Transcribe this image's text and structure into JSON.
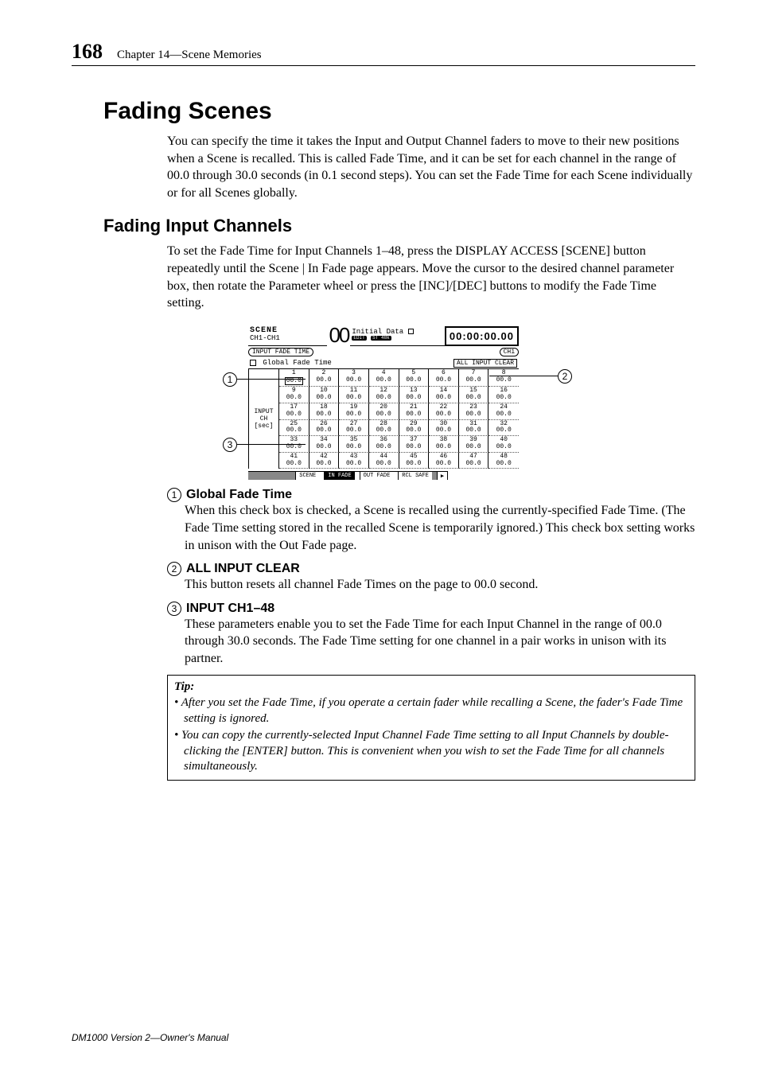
{
  "page_number": "168",
  "chapter": "Chapter 14—Scene Memories",
  "h1": "Fading Scenes",
  "intro": "You can specify the time it takes the Input and Output Channel faders to move to their new positions when a Scene is recalled. This is called Fade Time, and it can be set for each channel in the range of 00.0 through 30.0 seconds (in 0.1 second steps). You can set the Fade Time for each Scene individually or for all Scenes globally.",
  "h2": "Fading Input Channels",
  "h2_body": "To set the Fade Time for Input Channels 1–48, press the DISPLAY ACCESS [SCENE] button repeatedly until the Scene | In Fade page appears. Move the cursor to the desired channel parameter box, then rotate the Parameter wheel or press the [INC]/[DEC] buttons to modify the Fade Time setting.",
  "items": [
    {
      "num": "1",
      "label": "Global Fade Time",
      "desc": "When this check box is checked, a Scene is recalled using the currently-specified Fade Time. (The Fade Time setting stored in the recalled Scene is temporarily ignored.) This check box setting works in unison with the Out Fade page."
    },
    {
      "num": "2",
      "label": "ALL INPUT CLEAR",
      "desc": "This button resets all channel Fade Times on the page to 00.0 second."
    },
    {
      "num": "3",
      "label": "INPUT CH1–48",
      "desc": "These parameters enable you to set the Fade Time for each Input Channel in the range of 00.0 through 30.0 seconds. The Fade Time setting for one channel in a pair works in unison with its partner."
    }
  ],
  "tip_title": "Tip:",
  "tips": [
    "After you set the Fade Time, if you operate a certain fader while recalling a Scene, the fader's Fade Time setting is ignored.",
    "You can copy the currently-selected Input Channel Fade Time setting to all Input Channels by double-clicking the [ENTER] button. This is convenient when you wish to set the Fade Time for all channels simultaneously."
  ],
  "footer": "DM1000 Version 2—Owner's Manual",
  "lcd": {
    "scene": "SCENE",
    "ch": "CH1-CH1",
    "big": "00",
    "edit": "EDIT",
    "initial": "Initial Data",
    "st48": "ST 48k",
    "tc": "00:00:00.00",
    "section": "INPUT FADE TIME",
    "ch1": "CH1",
    "global": "Global Fade Time",
    "allclear": "ALL INPUT CLEAR",
    "left1": "INPUT",
    "left2": "CH",
    "left3": "[sec]",
    "value": "00.0",
    "tabs": [
      "SCENE",
      "IN FADE",
      "OUT FADE",
      "RCL SAFE"
    ],
    "arrow": "▶"
  }
}
